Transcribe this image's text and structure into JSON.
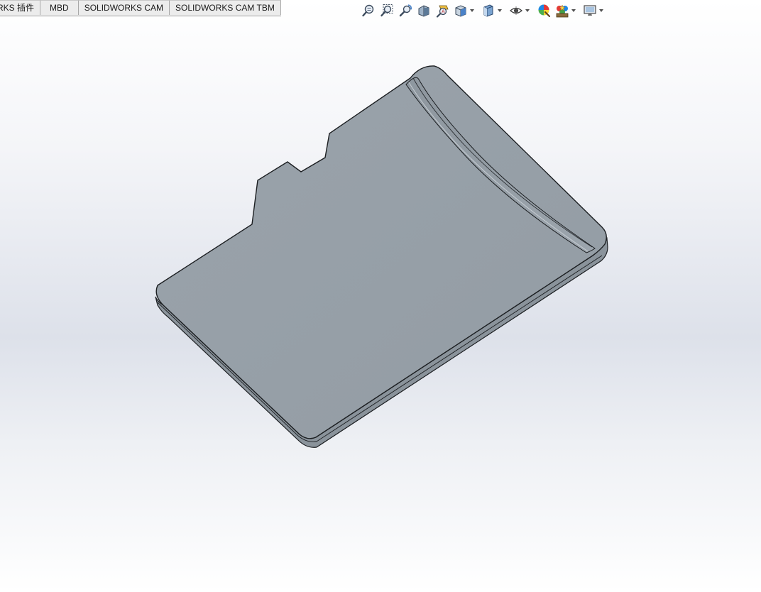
{
  "command_tabs": [
    {
      "label": "RKS 插件"
    },
    {
      "label": "MBD"
    },
    {
      "label": "SOLIDWORKS CAM"
    },
    {
      "label": "SOLIDWORKS CAM TBM"
    }
  ],
  "heads_up_toolbar": {
    "buttons": [
      {
        "icon": "zoom-to-fit-icon"
      },
      {
        "icon": "zoom-to-area-icon"
      },
      {
        "icon": "previous-view-icon"
      },
      {
        "icon": "section-view-icon"
      },
      {
        "icon": "dynamic-annotation-views-icon"
      },
      {
        "icon": "view-orientation-icon",
        "has_dropdown": true
      },
      {
        "icon": "display-style-icon",
        "has_dropdown": true
      },
      {
        "icon": "hide-show-items-icon",
        "has_dropdown": true
      },
      {
        "icon": "edit-appearance-icon"
      },
      {
        "icon": "apply-scene-icon",
        "has_dropdown": true
      },
      {
        "icon": "view-settings-icon",
        "has_dropdown": true
      }
    ]
  },
  "graphics_area": {
    "model": "micro-sd-card-part",
    "model_color": "#97a0a8",
    "edge_color": "#1c1f22"
  }
}
